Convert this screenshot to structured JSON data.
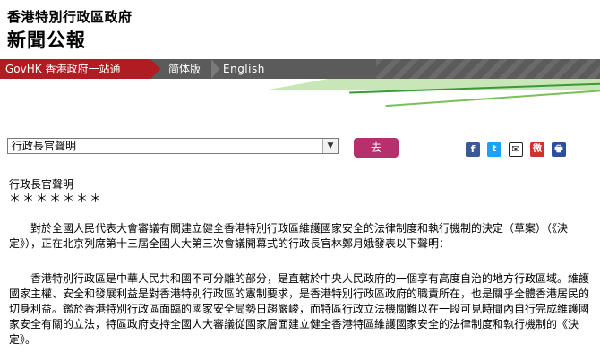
{
  "header": {
    "title_line1": "香港特別行政區政府",
    "title_line2": "新聞公報"
  },
  "nav": {
    "govhk": "GovHK 香港政府一站通",
    "simplified": "简体版",
    "english": "English"
  },
  "toolbar": {
    "select_value": "行政長官聲明",
    "dropdown_arrow": "▼",
    "go_label": "去"
  },
  "share": {
    "facebook": "f",
    "twitter": "t",
    "email": "✉",
    "weibo": "微",
    "print": "🖶"
  },
  "colors": {
    "govhk_red": "#b01c22",
    "nav_gray": "#5b5b5b",
    "go_button": "#b5306c",
    "facebook": "#3b5998",
    "twitter": "#1da1f2",
    "weibo": "#d0312d",
    "print": "#2a4f9e"
  },
  "article": {
    "title": "行政長官聲明",
    "stars": "＊＊＊＊＊＊＊",
    "para1": "　　對於全國人民代表大會審議有關建立健全香港特別行政區維護國家安全的法律制度和執行機制的決定（草案）（《決定》），正在北京列席第十三屆全國人大第三次會議開幕式的行政長官林鄭月娥發表以下聲明：",
    "para2": "　　香港特別行政區是中華人民共和國不可分離的部分，是直轄於中央人民政府的一個享有高度自治的地方行政區域。維護國家主權、安全和發展利益是對香港特別行政區的憲制要求，是香港特別行政區政府的職責所在，也是關乎全體香港居民的切身利益。鑑於香港特別行政區面臨的國家安全局勢日趨嚴峻，而特區行政立法機關難以在一段可見時間內自行完成維護國家安全有關的立法，特區政府支持全國人大審議從國家層面建立健全香港特區維護國家安全的法律制度和執行機制的《決定》。"
  }
}
